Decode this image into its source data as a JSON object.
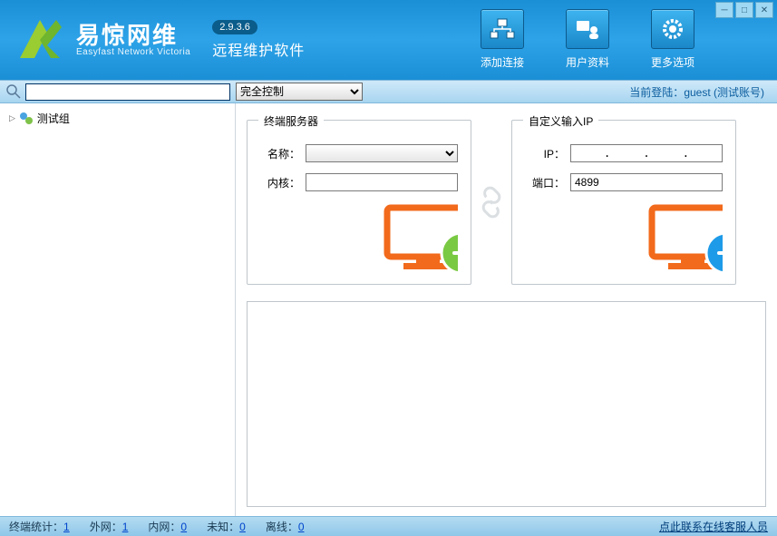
{
  "header": {
    "app_name_cn": "易惊网维",
    "app_name_en": "Easyfast Network Victoria",
    "version": "2.9.3.6",
    "tagline": "远程维护软件",
    "buttons": {
      "add_connection": "添加连接",
      "user_profile": "用户资料",
      "more_options": "更多选项"
    }
  },
  "toolbar": {
    "search_value": "",
    "mode_selected": "完全控制",
    "login_prefix": "当前登陆：",
    "login_user": "guest (测试账号)"
  },
  "sidebar": {
    "root_group": "测试组"
  },
  "panel_terminal": {
    "title": "终端服务器",
    "label_name": "名称：",
    "label_kernel": "内核：",
    "name_value": "",
    "kernel_value": ""
  },
  "panel_custom": {
    "title": "自定义输入IP",
    "label_ip": "IP：",
    "label_port": "端口：",
    "ip_value": ".     .     .",
    "port_value": "4899"
  },
  "status": {
    "total_label": "终端统计：",
    "total_value": "1",
    "wan_label": "外网：",
    "wan_value": "1",
    "lan_label": "内网：",
    "lan_value": "0",
    "unknown_label": "未知：",
    "unknown_value": "0",
    "offline_label": "离线：",
    "offline_value": "0",
    "contact": "点此联系在线客服人员"
  }
}
